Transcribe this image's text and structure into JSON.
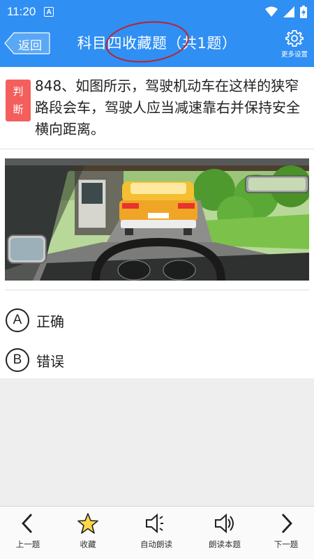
{
  "status_bar": {
    "time": "11:20",
    "notification_letter": "A"
  },
  "header": {
    "back_label": "返回",
    "title": "科目四收藏题（共1题）",
    "settings_label": "更多设置"
  },
  "question": {
    "type_badge": [
      "判",
      "断"
    ],
    "text": "848、如图所示，驾驶机动车在这样的狭窄路段会车，驾驶人应当减速靠右并保持安全横向距离。"
  },
  "options": [
    {
      "letter": "A",
      "text": "正确"
    },
    {
      "letter": "B",
      "text": "错误"
    }
  ],
  "bottom_bar": [
    {
      "label": "上一题",
      "icon": "chevron-left-icon"
    },
    {
      "label": "收藏",
      "icon": "star-icon"
    },
    {
      "label": "自动朗读",
      "icon": "speaker-auto-icon"
    },
    {
      "label": "朗读本题",
      "icon": "speaker-icon"
    },
    {
      "label": "下一题",
      "icon": "chevron-right-icon"
    }
  ],
  "colors": {
    "header_blue": "#2f8ff3",
    "badge_red": "#f25f5c",
    "circle_annotation": "#c0202a",
    "star_yellow": "#ffd84a"
  }
}
